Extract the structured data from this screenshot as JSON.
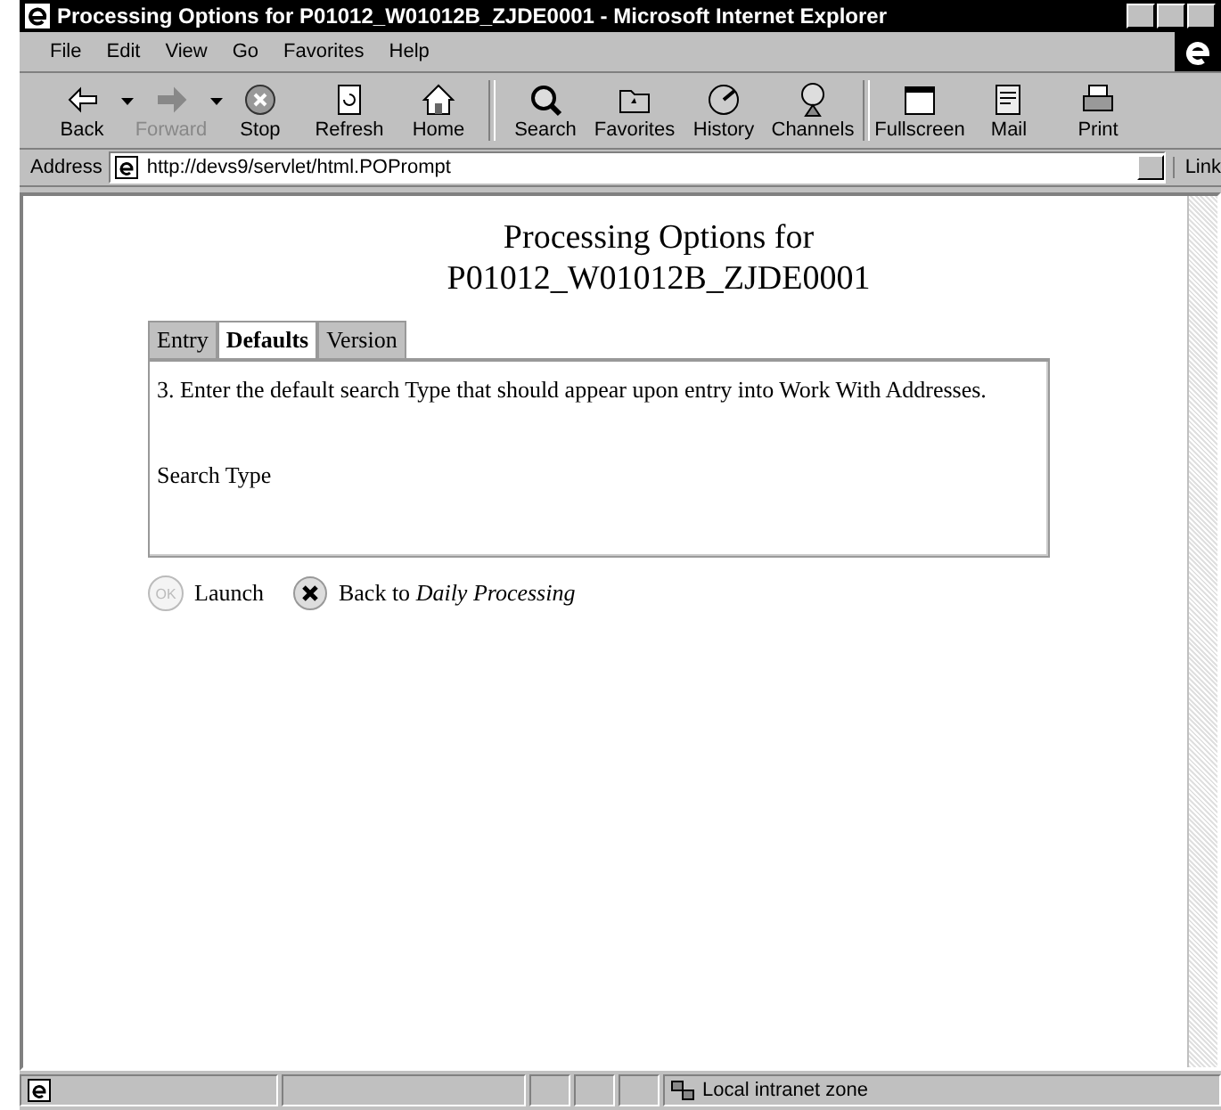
{
  "window": {
    "title": "Processing Options for P01012_W01012B_ZJDE0001 - Microsoft Internet Explorer"
  },
  "menu": [
    "File",
    "Edit",
    "View",
    "Go",
    "Favorites",
    "Help"
  ],
  "toolbar": [
    {
      "label": "Back",
      "disabled": false,
      "dropdown": true
    },
    {
      "label": "Forward",
      "disabled": true,
      "dropdown": true
    },
    {
      "label": "Stop",
      "disabled": false,
      "dropdown": false
    },
    {
      "label": "Refresh",
      "disabled": false,
      "dropdown": false
    },
    {
      "label": "Home",
      "disabled": false,
      "dropdown": false
    },
    {
      "label": "Search",
      "disabled": false,
      "dropdown": false
    },
    {
      "label": "Favorites",
      "disabled": false,
      "dropdown": false
    },
    {
      "label": "History",
      "disabled": false,
      "dropdown": false
    },
    {
      "label": "Channels",
      "disabled": false,
      "dropdown": false
    },
    {
      "label": "Fullscreen",
      "disabled": false,
      "dropdown": false
    },
    {
      "label": "Mail",
      "disabled": false,
      "dropdown": false
    },
    {
      "label": "Print",
      "disabled": false,
      "dropdown": false
    }
  ],
  "address": {
    "label": "Address",
    "value": "http://devs9/servlet/html.POPrompt",
    "links": "Link"
  },
  "page": {
    "heading": [
      "Processing Options for",
      "P01012_W01012B_ZJDE0001"
    ],
    "tabs": [
      {
        "label": "Entry",
        "selected": false
      },
      {
        "label": "Defaults",
        "selected": true
      },
      {
        "label": "Version",
        "selected": false
      }
    ],
    "description": "3. Enter the default search Type that should appear upon entry into Work With Addresses.",
    "field_label": "Search Type",
    "actions": [
      {
        "label": "Launch",
        "icon": "OK",
        "disabled": true
      },
      {
        "label": "Back to *Daily Processing*",
        "disabled": false
      }
    ]
  },
  "status_bar": {
    "zone": "Local intranet zone"
  }
}
